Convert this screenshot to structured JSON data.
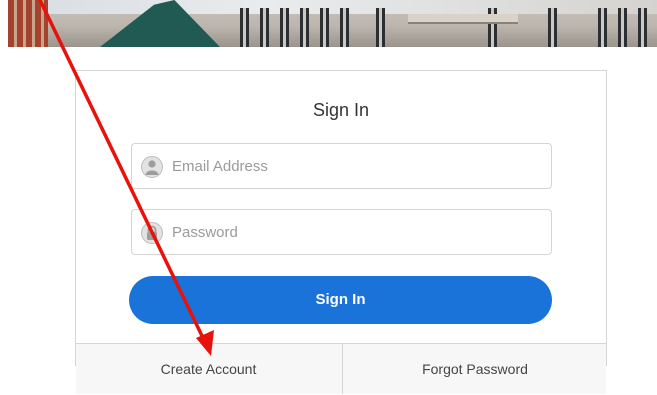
{
  "signin_form": {
    "title": "Sign In",
    "email": {
      "placeholder": "Email Address",
      "value": ""
    },
    "password": {
      "placeholder": "Password",
      "value": ""
    },
    "submit_label": "Sign In"
  },
  "footer_links": {
    "create_account": "Create Account",
    "forgot_password": "Forgot Password"
  },
  "colors": {
    "primary_button": "#1a73d9",
    "annotation_arrow": "#e8120c",
    "card_border": "#d6d6d6"
  },
  "annotation": {
    "type": "arrow",
    "points_to": "Create Account"
  }
}
